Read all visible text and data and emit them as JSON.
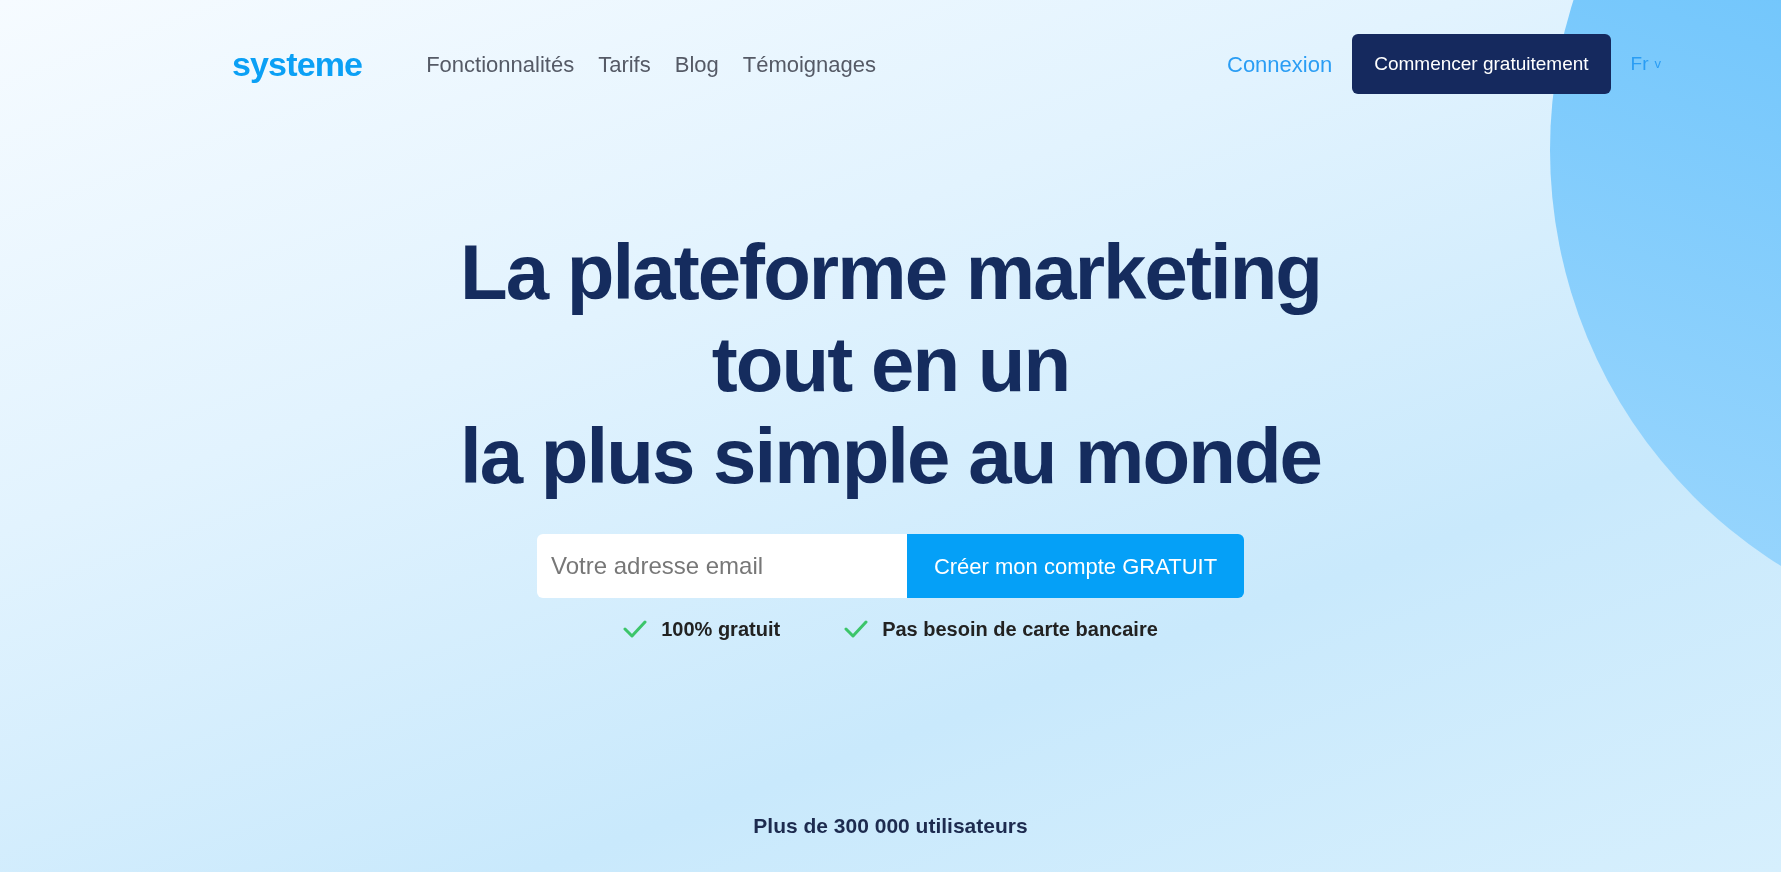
{
  "header": {
    "logo": "systeme",
    "nav": [
      {
        "label": "Fonctionnalités"
      },
      {
        "label": "Tarifs"
      },
      {
        "label": "Blog"
      },
      {
        "label": "Témoignages"
      }
    ],
    "login": "Connexion",
    "cta": "Commencer gratuitement",
    "language": "Fr",
    "language_caret": "v"
  },
  "hero": {
    "headline": [
      "La plateforme marketing",
      "tout en un",
      "la plus simple au monde"
    ],
    "form": {
      "placeholder": "Votre adresse email",
      "button": "Créer mon compte GRATUIT"
    },
    "benefits": [
      "100% gratuit",
      "Pas besoin de carte bancaire"
    ],
    "users": "Plus de 300 000 utilisateurs"
  }
}
